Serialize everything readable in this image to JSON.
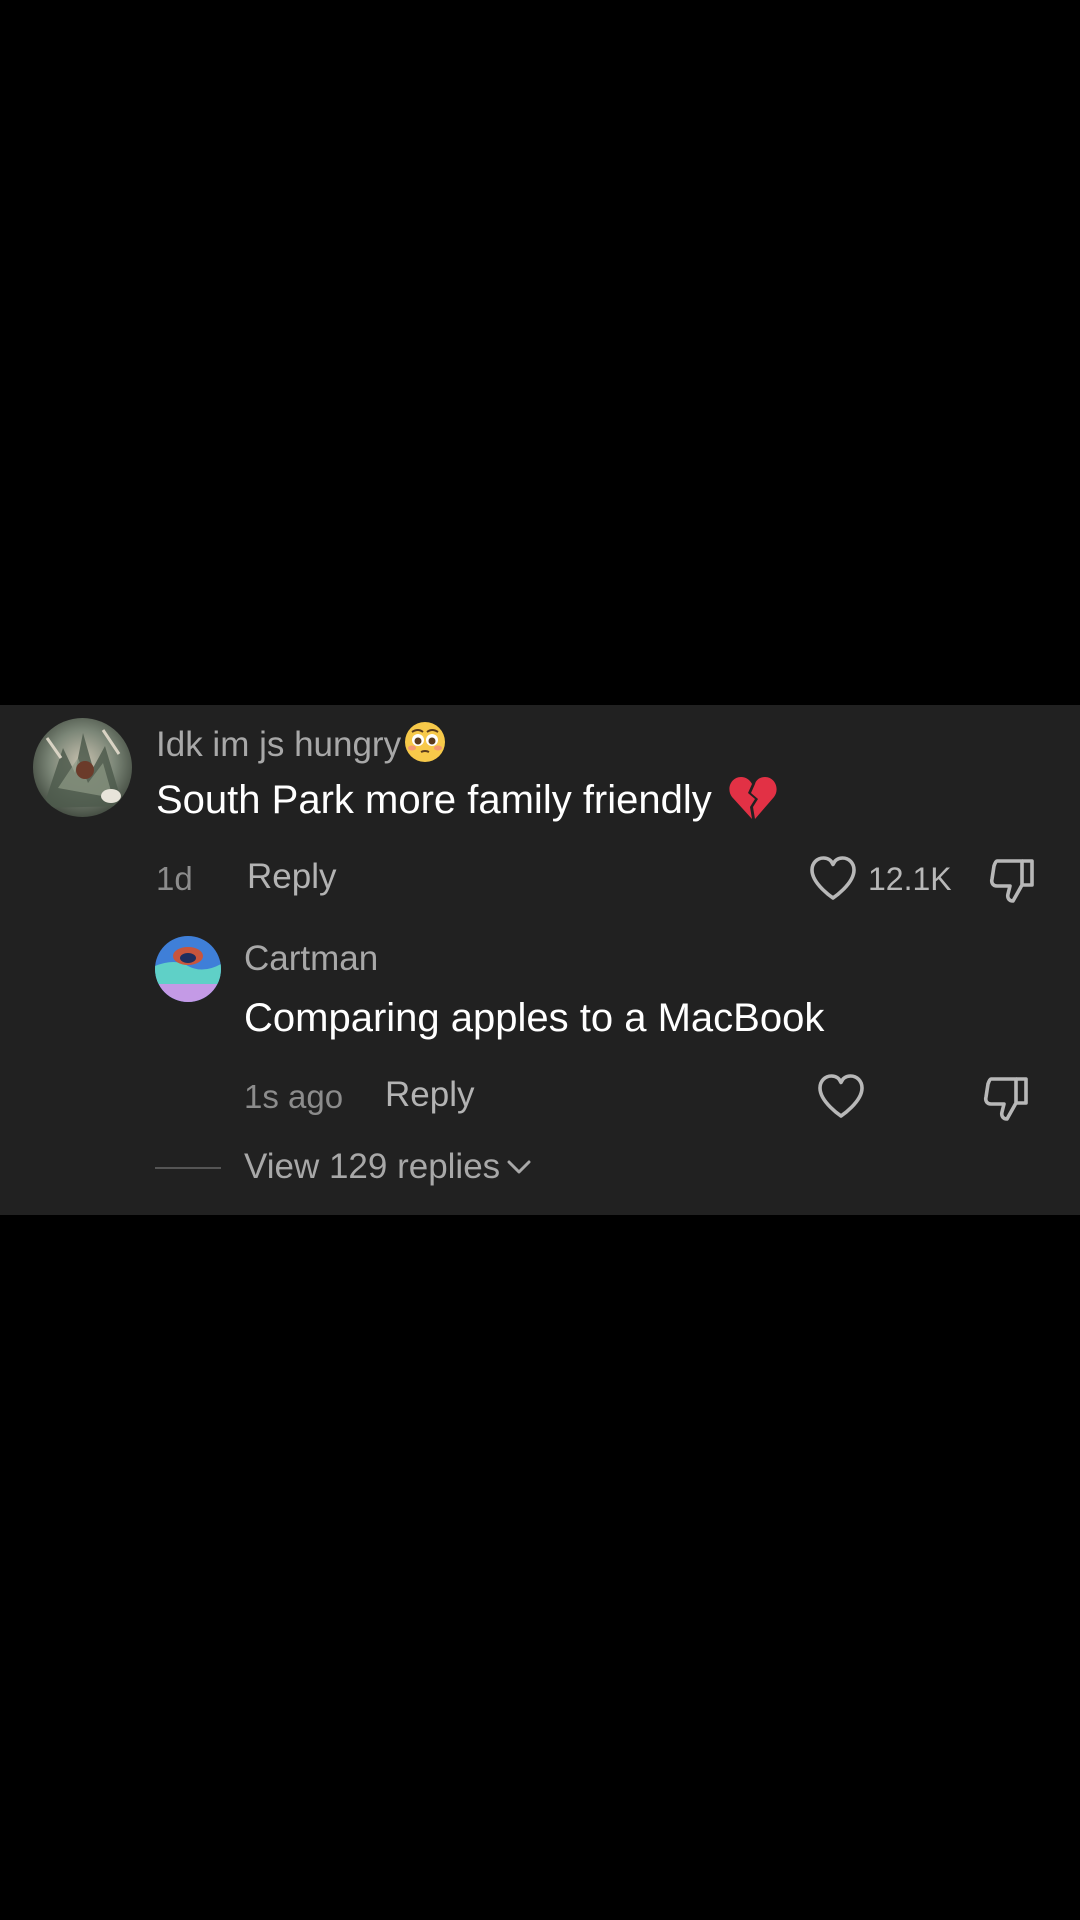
{
  "comment": {
    "username": "Idk im js hungry",
    "username_emoji": "flushed-face-emoji",
    "text": "South Park more family friendly",
    "text_emoji": "broken-heart-emoji",
    "time": "1d",
    "reply_label": "Reply",
    "like_count": "12.1K",
    "icons": {
      "like": "heart-outline-icon",
      "dislike": "thumbs-down-icon"
    }
  },
  "reply": {
    "username": "Cartman",
    "text": "Comparing apples to a MacBook",
    "time": "1s ago",
    "reply_label": "Reply"
  },
  "view_replies": {
    "label": "View 129 replies"
  },
  "colors": {
    "background": "#000000",
    "panel": "#212121",
    "username": "#a8a8a8",
    "body_text": "#ffffff",
    "muted": "#8c8c8c"
  }
}
